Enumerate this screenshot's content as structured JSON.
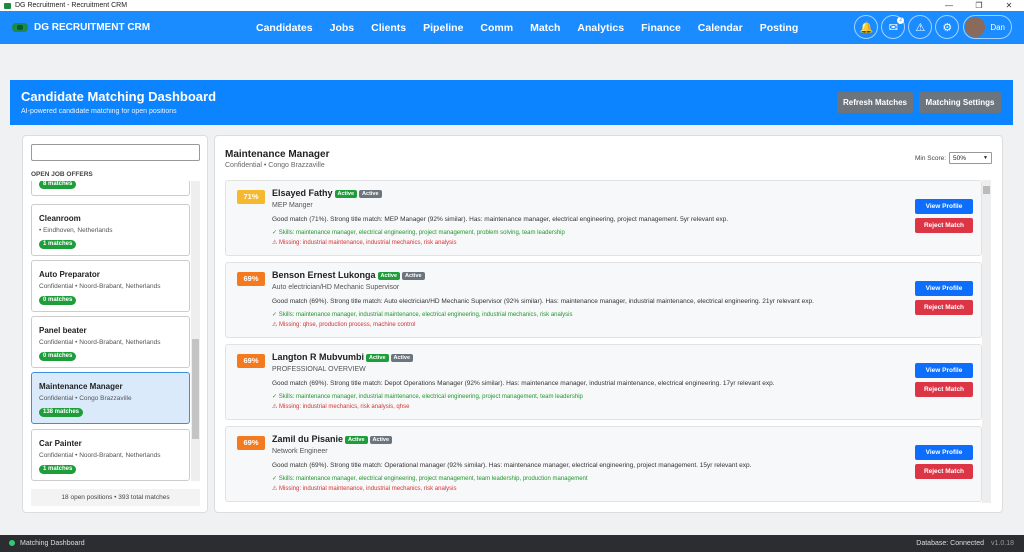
{
  "window": {
    "title": "DG Recruitment - Recruitment CRM",
    "controls": [
      "—",
      "❐",
      "✕"
    ]
  },
  "nav": {
    "brand": "DG RECRUITMENT CRM",
    "items": [
      "Candidates",
      "Jobs",
      "Clients",
      "Pipeline",
      "Comm",
      "Match",
      "Analytics",
      "Finance",
      "Calendar",
      "Posting"
    ],
    "notif_count": "2",
    "user": "Dan"
  },
  "hero": {
    "title": "Candidate Matching Dashboard",
    "subtitle": "AI-powered candidate matching for open positions",
    "refresh": "Refresh Matches",
    "settings": "Matching Settings"
  },
  "left": {
    "search_placeholder": "",
    "section": "OPEN JOB OFFERS",
    "jobs": [
      {
        "title": "",
        "sub": "",
        "matches": "8 matches"
      },
      {
        "title": "Cleanroom",
        "sub": "•  Eindhoven, Netherlands",
        "matches": "1 matches"
      },
      {
        "title": "Auto Preparator",
        "sub": "Confidential  •  Noord-Brabant, Netherlands",
        "matches": "0 matches"
      },
      {
        "title": "Panel beater",
        "sub": "Confidential  •  Noord-Brabant, Netherlands",
        "matches": "0 matches"
      },
      {
        "title": "Maintenance Manager",
        "sub": "Confidential  •  Congo Brazzaville",
        "matches": "138 matches"
      },
      {
        "title": "Car Painter",
        "sub": "Confidential  •  Noord-Brabant, Netherlands",
        "matches": "1 matches"
      }
    ],
    "footer": "18  open positions •  393  total matches"
  },
  "right": {
    "title": "Maintenance Manager",
    "subtitle": "Confidential  •  Congo Brazzaville",
    "min_score_label": "Min Score:",
    "min_score": "50%",
    "view": "View Profile",
    "reject": "Reject Match",
    "matches": [
      {
        "score": "71%",
        "color": "#f5b82e",
        "name": "Elsayed Fathy",
        "tags": [
          "Active",
          "Active"
        ],
        "role": "MEP Manger",
        "summary": "Good match (71%). Strong title match: MEP Manager (92% similar). Has: maintenance manager, electrical engineering, project management. 5yr relevant exp.",
        "skills": "✓ Skills:  maintenance manager, electrical engineering, project management, problem solving, team leadership",
        "missing": "⚠ Missing:  industrial maintenance, industrial mechanics, risk analysis"
      },
      {
        "score": "69%",
        "color": "#f47a20",
        "name": "Benson Ernest Lukonga",
        "tags": [
          "Active",
          "Active"
        ],
        "role": "Auto electrician/HD Mechanic Supervisor",
        "summary": "Good match (69%). Strong title match: Auto electrician/HD Mechanic Supervisor (92% similar). Has: maintenance manager, industrial maintenance, electrical engineering. 21yr relevant exp.",
        "skills": "✓ Skills:  maintenance manager, industrial maintenance, electrical engineering, industrial mechanics, risk analysis",
        "missing": "⚠ Missing:  qhse, production process, machine control"
      },
      {
        "score": "69%",
        "color": "#f47a20",
        "name": "Langton R Mubvumbi",
        "tags": [
          "Active",
          "Active"
        ],
        "role": "PROFESSIONAL OVERVIEW",
        "summary": "Good match (69%). Strong title match: Depot Operations Manager (92% similar). Has: maintenance manager, industrial maintenance, electrical engineering. 17yr relevant exp.",
        "skills": "✓ Skills:  maintenance manager, industrial maintenance, electrical engineering, project management, team leadership",
        "missing": "⚠ Missing:  industrial mechanics, risk analysis, qhse"
      },
      {
        "score": "69%",
        "color": "#f47a20",
        "name": "Zamil du Pisanie",
        "tags": [
          "Active",
          "Active"
        ],
        "role": "Network Engineer",
        "summary": "Good match (69%). Strong title match: Operational manager (92% similar). Has: maintenance manager, electrical engineering, project management. 15yr relevant exp.",
        "skills": "✓ Skills:  maintenance manager, electrical engineering, project management, team leadership, production management",
        "missing": "⚠ Missing:  industrial maintenance, industrial mechanics, risk analysis"
      }
    ]
  },
  "status": {
    "left": "Matching Dashboard",
    "right": "Database: Connected",
    "version": "v1.0.18"
  },
  "colors": {
    "nav": "#1a8cff",
    "hero": "#0d84ff",
    "green": "#1e9e3a",
    "blue": "#0d6efd",
    "red": "#dc3545"
  }
}
